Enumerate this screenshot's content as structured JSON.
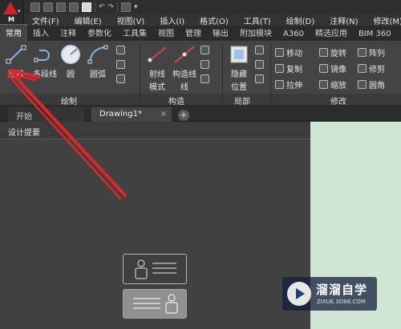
{
  "app": {
    "logo_letter": "M"
  },
  "quick_access": {
    "icons": [
      "new-icon",
      "open-icon",
      "save-icon",
      "save-as-icon",
      "print-icon",
      "undo-icon",
      "redo-icon",
      "workspace-icon"
    ]
  },
  "menu_bar": {
    "items": [
      "文件(F)",
      "编辑(E)",
      "视图(V)",
      "插入(I)",
      "格式(O)",
      "工具(T)",
      "绘制(D)",
      "注释(N)",
      "修改(M)"
    ]
  },
  "ribbon_tabs": {
    "active": "常用",
    "items": [
      "常用",
      "插入",
      "注释",
      "参数化",
      "工具集",
      "视图",
      "管理",
      "输出",
      "附加模块",
      "A360",
      "精选应用",
      "BIM 360"
    ]
  },
  "ribbon": {
    "draw_panel": {
      "title": "绘制",
      "tools": [
        "直线",
        "多段线",
        "圆",
        "圆弧"
      ]
    },
    "construct_panel": {
      "title": "构造",
      "tools": [
        "射线",
        "构造线"
      ],
      "ray_sub": "模式",
      "construct_sub": "线"
    },
    "layers_panel": {
      "title": "局部",
      "tool": "隐藏",
      "tool_sub": "位置"
    },
    "modify_panel": {
      "title": "修改",
      "rows": [
        [
          "移动",
          "旋转",
          "阵列"
        ],
        [
          "复制",
          "镜像",
          "修剪"
        ],
        [
          "拉伸",
          "缩放",
          "圆角"
        ]
      ]
    }
  },
  "file_tabs": {
    "start": "开始",
    "drawing": "Drawing1*",
    "close_glyph": "×",
    "add_glyph": "+"
  },
  "section_header": "设计提要",
  "watermark": {
    "title": "溜溜自学",
    "url": "ZIXUE.3D66.COM"
  },
  "colors": {
    "annotation_red": "#e0262b",
    "side_panel": "#cfe6d4",
    "brand_red": "#d61f26"
  }
}
